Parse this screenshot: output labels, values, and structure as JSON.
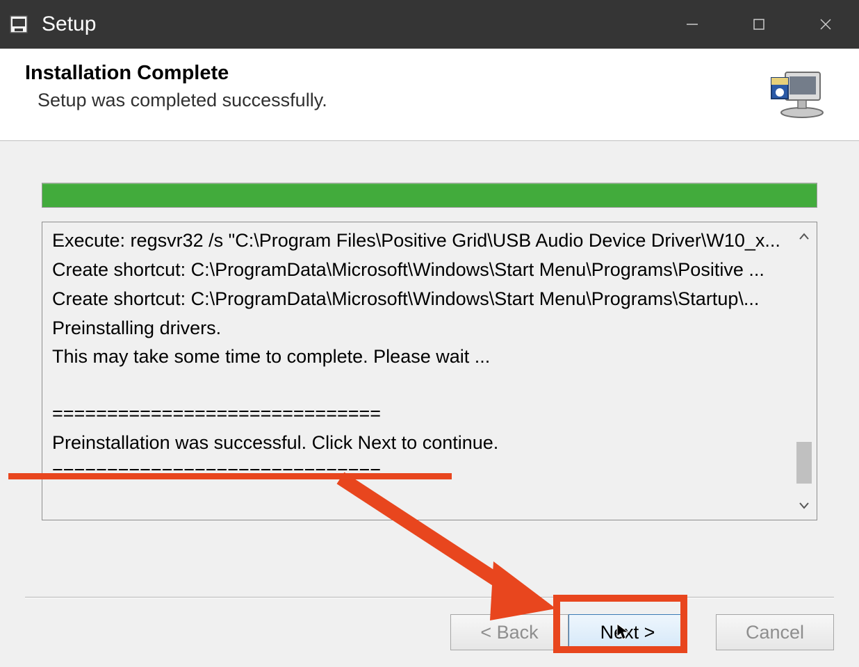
{
  "window": {
    "title": "Setup"
  },
  "header": {
    "title": "Installation Complete",
    "subtitle": "Setup was completed successfully."
  },
  "log": {
    "lines": [
      "Execute: regsvr32 /s \"C:\\Program Files\\Positive Grid\\USB Audio Device Driver\\W10_x...",
      "Create shortcut: C:\\ProgramData\\Microsoft\\Windows\\Start Menu\\Programs\\Positive ...",
      "Create shortcut: C:\\ProgramData\\Microsoft\\Windows\\Start Menu\\Programs\\Startup\\...",
      "Preinstalling drivers.",
      "This may take some time to complete. Please wait ..."
    ],
    "divider": "==============================",
    "success_line": "Preinstallation was successful. Click Next to continue.",
    "divider2": "=============================="
  },
  "buttons": {
    "back": "< Back",
    "next": "Next >",
    "cancel": "Cancel"
  },
  "progress": {
    "percent": 100
  },
  "annotation": {
    "highlight_target": "success-line",
    "arrow_target": "next-button"
  }
}
